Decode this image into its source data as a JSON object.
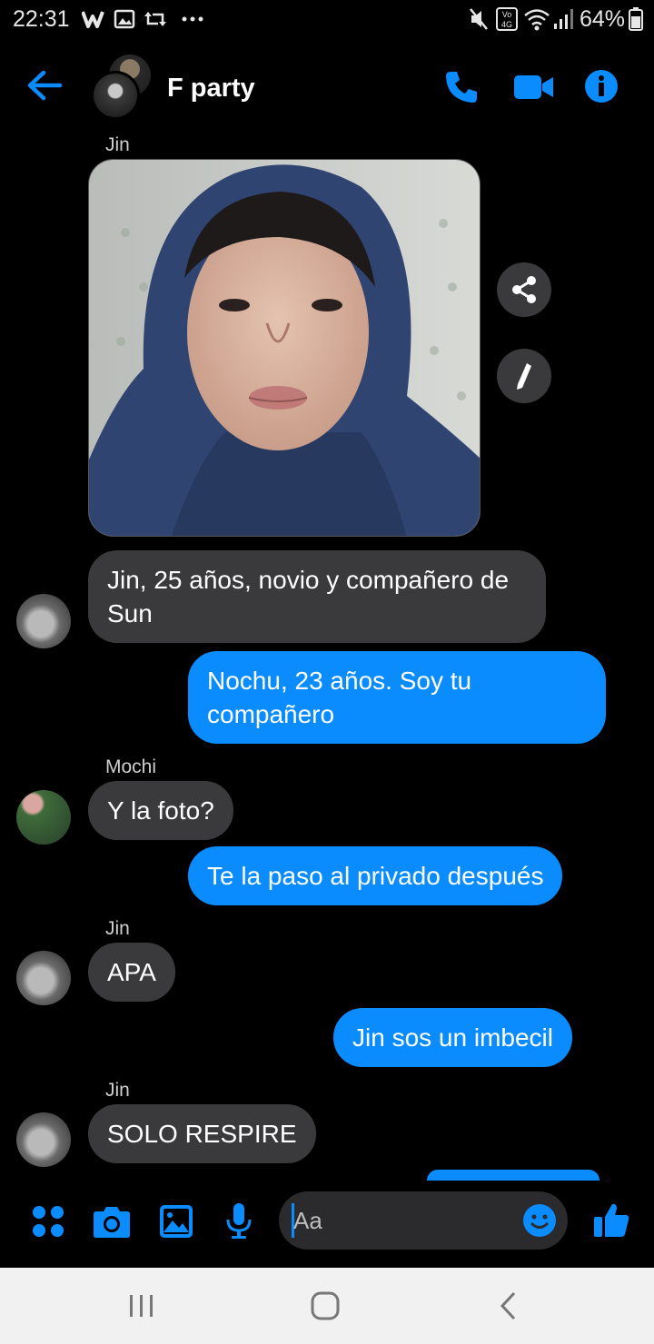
{
  "status_bar": {
    "time": "22:31",
    "battery": "64%"
  },
  "header": {
    "title": "F party"
  },
  "messages": [
    {
      "sender": "Jin"
    },
    {
      "text": "Jin, 25 años, novio y compañero de Sun"
    },
    {
      "text": "Nochu, 23 años. Soy tu compañero"
    },
    {
      "sender": "Mochi",
      "text": "Y la foto?"
    },
    {
      "text": "Te la paso al privado después"
    },
    {
      "sender": "Jin",
      "text": "APA"
    },
    {
      "text": "Jin sos un imbecil"
    },
    {
      "sender": "Jin",
      "text": "SOLO RESPIRE"
    }
  ],
  "composer": {
    "placeholder": "Aa"
  },
  "colors": {
    "accent": "#0a8cff",
    "incoming_bubble": "#3a3a3c",
    "background": "#000000"
  }
}
